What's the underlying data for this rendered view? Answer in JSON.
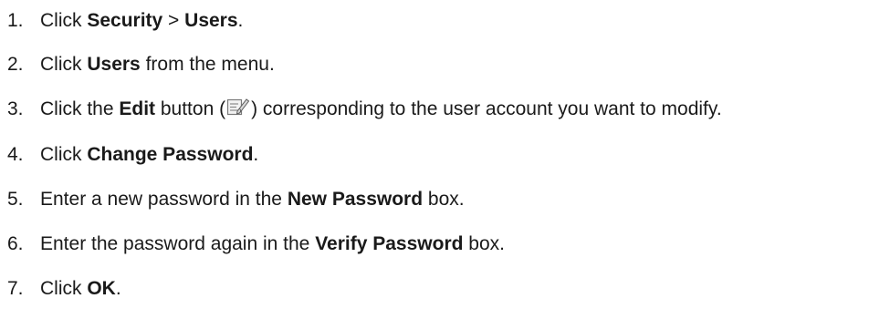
{
  "steps": [
    {
      "number": "1.",
      "parts": [
        "Click ",
        "Security",
        " > ",
        "Users",
        "."
      ]
    },
    {
      "number": "2.",
      "parts": [
        "Click ",
        "Users",
        " from the menu."
      ]
    },
    {
      "number": "3.",
      "parts": [
        "Click the ",
        "Edit",
        " button (",
        ") corresponding to the user account you want to modify."
      ]
    },
    {
      "number": "4.",
      "parts": [
        "Click ",
        "Change Password",
        "."
      ]
    },
    {
      "number": "5.",
      "parts": [
        "Enter a new password in the ",
        "New Password",
        " box."
      ]
    },
    {
      "number": "6.",
      "parts": [
        "Enter the password again in the ",
        "Verify Password",
        " box."
      ]
    },
    {
      "number": "7.",
      "parts": [
        "Click ",
        "OK",
        "."
      ]
    }
  ],
  "icons": {
    "edit": "edit-icon"
  }
}
